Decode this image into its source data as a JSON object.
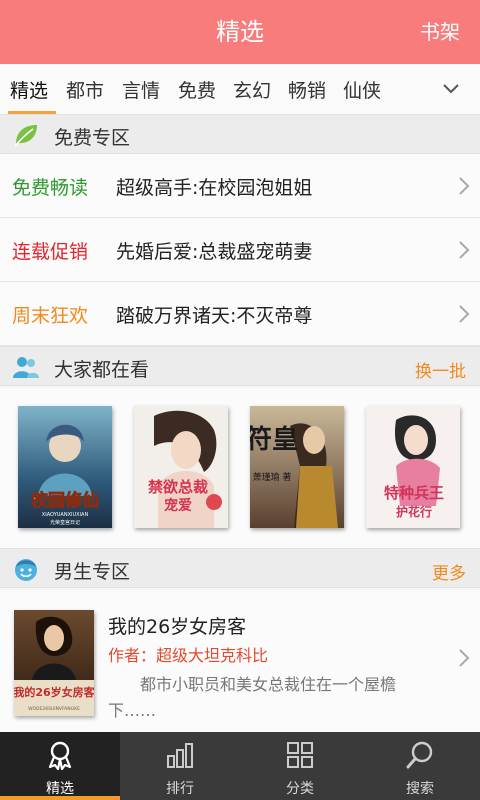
{
  "header": {
    "title": "精选",
    "shelf_label": "书架"
  },
  "tabs": [
    "精选",
    "都市",
    "言情",
    "免费",
    "玄幻",
    "畅销",
    "仙侠"
  ],
  "free_zone": {
    "title": "免费专区",
    "rows": [
      {
        "tag": "免费畅读",
        "tag_color": "#2e9a2e",
        "title": "超级高手:在校园泡姐姐"
      },
      {
        "tag": "连载促销",
        "tag_color": "#e3252b",
        "title": "先婚后爱:总裁盛宠萌妻"
      },
      {
        "tag": "周末狂欢",
        "tag_color": "#f08a1c",
        "title": "踏破万界诸天:不灭帝尊"
      }
    ]
  },
  "popular": {
    "title": "大家都在看",
    "action": "换一批",
    "covers": [
      {
        "text": "校园修仙",
        "sub": "XIAOYUANXIUXIAN",
        "author": "光荣皇宫日记"
      },
      {
        "text": "禁欲总裁",
        "sub": "宠爱",
        "author": ""
      },
      {
        "text": "符皇",
        "sub": "",
        "author": "萧瑾瑜 著"
      },
      {
        "text": "特种兵王",
        "sub": "护花行",
        "author": ""
      }
    ]
  },
  "male_zone": {
    "title": "男生专区",
    "action": "更多",
    "book": {
      "title": "我的26岁女房客",
      "author": "作者：超级大坦克科比",
      "desc": "都市小职员和美女总裁住在一个屋檐下……",
      "cover_text": "我的26岁女房客",
      "cover_sub": "WODE26SUINVFANGKE"
    }
  },
  "bottom_nav": [
    {
      "label": "精选",
      "icon": "medal-icon"
    },
    {
      "label": "排行",
      "icon": "bar-chart-icon"
    },
    {
      "label": "分类",
      "icon": "grid-icon"
    },
    {
      "label": "搜索",
      "icon": "search-icon"
    }
  ],
  "colors": {
    "header": "#f97c7c",
    "accent": "#f2a53a",
    "nav_bg": "#3a3a3a"
  }
}
